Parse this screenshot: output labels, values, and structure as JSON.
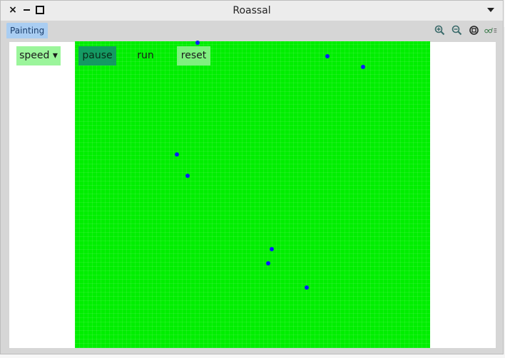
{
  "window": {
    "title": "Roassal",
    "close_glyph": "×",
    "min_icon": "minimize-icon",
    "max_icon": "maximize-icon",
    "menu_icon": "chevron-down-icon"
  },
  "tabs": [
    {
      "label": "Painting",
      "active": true
    }
  ],
  "toolbar_icons": [
    "zoom-in-icon",
    "zoom-out-icon",
    "zoom-fit-icon",
    "glasses-menu-icon"
  ],
  "controls": {
    "speed_label": "speed ▾",
    "pause_label": "pause",
    "run_label": "run",
    "reset_label": "reset"
  },
  "canvas": {
    "grid_color": "#00ee00",
    "dot_color": "#0a1aff"
  },
  "colors": {
    "tab_active": "#a9cdf2",
    "speed_bg": "#9bf59b",
    "pause_bg": "#149a63",
    "reset_bg": "#7ff07f"
  }
}
